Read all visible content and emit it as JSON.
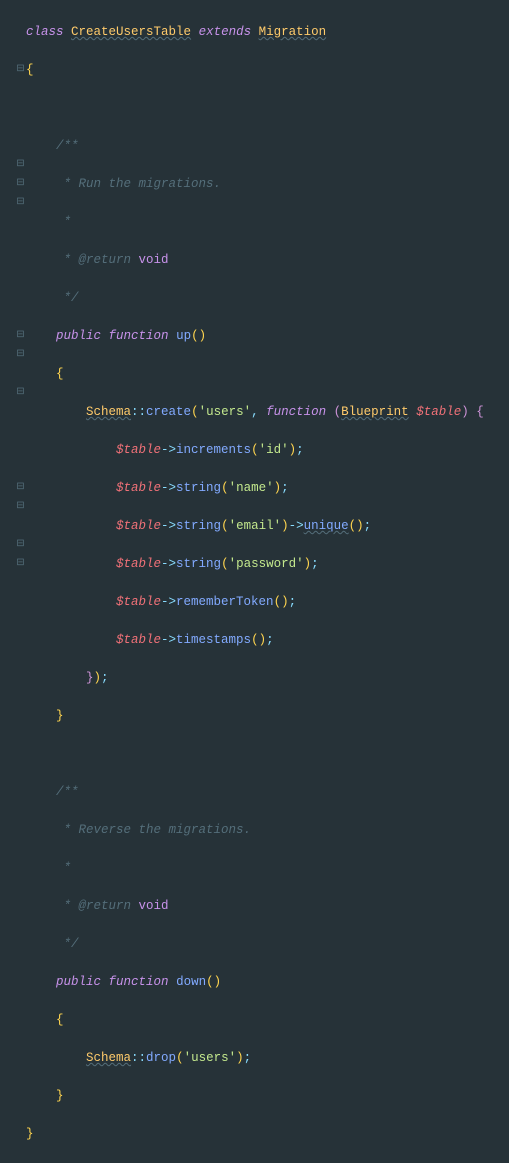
{
  "keywords": {
    "class": "class",
    "extends": "extends",
    "public": "public",
    "function": "function",
    "void": "void"
  },
  "classes": {
    "CreateUsersTable": "CreateUsersTable",
    "Migration": "Migration",
    "Schema": "Schema",
    "Blueprint": "Blueprint"
  },
  "fns": {
    "up": "up",
    "down": "down",
    "create": "create",
    "increments": "increments",
    "string": "string",
    "unique": "unique",
    "rememberToken": "rememberToken",
    "timestamps": "timestamps",
    "drop": "drop"
  },
  "vars": {
    "table": "$table"
  },
  "strings": {
    "users": "'users'",
    "id": "'id'",
    "name": "'name'",
    "email": "'email'",
    "password": "'password'"
  },
  "comments": {
    "openDoc": "/**",
    "runMig": " * Run the migrations.",
    "star": " *",
    "returnTag": " * @return",
    "closeDoc": " */",
    "revMig": " * Reverse the migrations."
  }
}
